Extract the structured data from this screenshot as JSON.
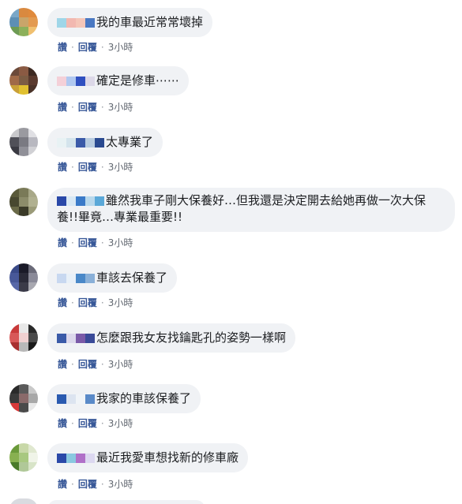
{
  "comments": [
    {
      "text": "我的車最近常常壞掉",
      "like": "讚",
      "reply": "回覆",
      "time": "3小時",
      "avatar_colors": [
        "#7aa7c7",
        "#d9893f",
        "#e08a3c",
        "#5d8fb5",
        "#c9a56a",
        "#e39a50",
        "#6d9b54",
        "#8cb05b",
        "#f0c070"
      ],
      "blur_colors": [
        "#9fd6e8",
        "#f2b8b0",
        "#f5c6b8",
        "#4a78c2"
      ]
    },
    {
      "text": "確定是修車⋯⋯",
      "like": "讚",
      "reply": "回覆",
      "time": "3小時",
      "avatar_colors": [
        "#6b4a3a",
        "#8a5a43",
        "#3d2a22",
        "#a06a48",
        "#7b5c44",
        "#5a3a2e",
        "#c9a038",
        "#e0c030",
        "#4a3228"
      ],
      "blur_colors": [
        "#f4d0d8",
        "#b0c8f0",
        "#3050c0",
        "#dcd8e8"
      ]
    },
    {
      "text": "太專業了",
      "like": "讚",
      "reply": "回覆",
      "time": "3小時",
      "avatar_colors": [
        "#c9c9cc",
        "#9a9aa0",
        "#e0e0e4",
        "#505058",
        "#7a7a82",
        "#b8b8c0",
        "#3a3a42",
        "#909098",
        "#d0d0d4"
      ],
      "blur_colors": [
        "#e8f2f4",
        "#d4e4ec",
        "#3a5aa8",
        "#b8cce0",
        "#2a4a90"
      ]
    },
    {
      "text": "雖然我車子剛大保養好…但我還是決定開去給她再做一次大保養!!畢竟…專業最重要!!",
      "like": "讚",
      "reply": "回覆",
      "time": "3小時",
      "avatar_colors": [
        "#5a5a3a",
        "#7a7a58",
        "#a8a888",
        "#484830",
        "#8c8c6a",
        "#b0b090",
        "#6a6a48",
        "#3a3a28",
        "#9a9a78"
      ],
      "blur_colors": [
        "#2a48a8",
        "#d8e8f4",
        "#3a7ac8",
        "#b8d8ec",
        "#5aa8d8"
      ]
    },
    {
      "text": "車該去保養了",
      "like": "讚",
      "reply": "回覆",
      "time": "3小時",
      "avatar_colors": [
        "#3a4a88",
        "#1a1a28",
        "#6a6a78",
        "#485898",
        "#2a2a38",
        "#8a8a98",
        "#5868a8",
        "#3a3a48",
        "#a8a8b0"
      ],
      "blur_colors": [
        "#c8d8f0",
        "#e8f0f8",
        "#4a88c8",
        "#8ab0d8"
      ]
    },
    {
      "text": "怎麼跟我女友找鑰匙孔的姿勢一樣啊",
      "like": "讚",
      "reply": "回覆",
      "time": "3小時",
      "avatar_colors": [
        "#c83a3a",
        "#e8e8e8",
        "#2a2a2a",
        "#d85858",
        "#f0d0d0",
        "#4a4a4a",
        "#a83030",
        "#b8b8b8",
        "#1a1a1a"
      ],
      "blur_colors": [
        "#3a5aa8",
        "#dcd8ec",
        "#7a5aa8",
        "#3a4a98"
      ]
    },
    {
      "text": "我家的車該保養了",
      "like": "讚",
      "reply": "回覆",
      "time": "3小時",
      "avatar_colors": [
        "#2a2a2a",
        "#5a5a5a",
        "#c8c8c8",
        "#3a3a3a",
        "#8a6a6a",
        "#a8a8a8",
        "#d83a3a",
        "#4a4a4a",
        "#e8e8e8"
      ],
      "blur_colors": [
        "#2a5ab0",
        "#dce4f0",
        "#f0f4f8",
        "#5a8ac8"
      ]
    },
    {
      "text": "最近我愛車想找新的修車廠",
      "like": "讚",
      "reply": "回覆",
      "time": "3小時",
      "avatar_colors": [
        "#6a9a3a",
        "#c8d8a8",
        "#e0e8d0",
        "#88b050",
        "#a8c880",
        "#f0f4e8",
        "#4a7a2a",
        "#b0c898",
        "#d8e4c8"
      ],
      "blur_colors": [
        "#2a48a8",
        "#8ac8e0",
        "#b070c8",
        "#dcd8f0"
      ]
    }
  ]
}
